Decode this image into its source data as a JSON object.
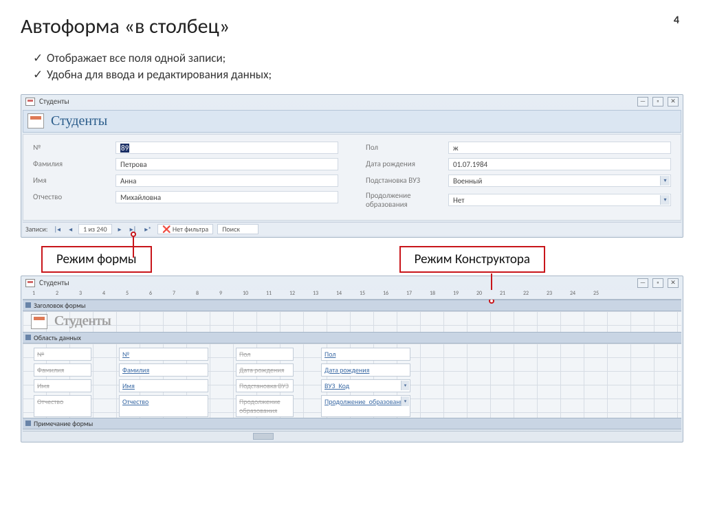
{
  "slide": {
    "number": "4",
    "title": "Автоформа «в столбец»",
    "bullets": [
      "Отображает все поля одной записи;",
      "Удобна для ввода и редактирования данных;"
    ]
  },
  "form_view": {
    "window_caption": "Студенты",
    "header_title": "Студенты",
    "left_fields": [
      {
        "label": "№",
        "value": "89"
      },
      {
        "label": "Фамилия",
        "value": "Петрова"
      },
      {
        "label": "Имя",
        "value": "Анна"
      },
      {
        "label": "Отчество",
        "value": "Михайловна"
      }
    ],
    "right_fields": [
      {
        "label": "Пол",
        "value": "ж"
      },
      {
        "label": "Дата рождения",
        "value": "01.07.1984"
      },
      {
        "label": "Подстановка ВУЗ",
        "value": "Военный",
        "dropdown": true
      },
      {
        "label": "Продолжение образования",
        "value": "Нет",
        "dropdown": true
      }
    ],
    "nav": {
      "label": "Записи:",
      "first": "|◂",
      "prev": "◂",
      "position": "1 из 240",
      "next": "▸",
      "last": "▸|",
      "new": "▸*",
      "no_filter": "Нет фильтра",
      "search": "Поиск"
    }
  },
  "callouts": {
    "form_mode": "Режим формы",
    "design_mode": "Режим Конструктора"
  },
  "design_view": {
    "window_caption": "Студенты",
    "ruler_marks": [
      "1",
      "2",
      "3",
      "4",
      "5",
      "6",
      "7",
      "8",
      "9",
      "10",
      "11",
      "12",
      "13",
      "14",
      "15",
      "16",
      "17",
      "18",
      "19",
      "20",
      "21",
      "22",
      "23",
      "24",
      "25"
    ],
    "sections": {
      "form_header": "Заголовок формы",
      "detail": "Область данных",
      "form_footer": "Примечание формы"
    },
    "header_title": "Студенты",
    "rows": [
      {
        "l1": "№",
        "f1": "№",
        "l2": "Пол",
        "f2": "Пол"
      },
      {
        "l1": "Фамилия",
        "f1": "Фамилия",
        "l2": "Дата рождения",
        "f2": "Дата рождения"
      },
      {
        "l1": "Имя",
        "f1": "Имя",
        "l2": "Подстановка ВУЗ",
        "f2": "ВУЗ_Код",
        "dd": true
      },
      {
        "l1": "Отчество",
        "f1": "Отчество",
        "l2": "Продолжение образования",
        "f2": "Продолжение_образования",
        "dd": true
      }
    ]
  }
}
